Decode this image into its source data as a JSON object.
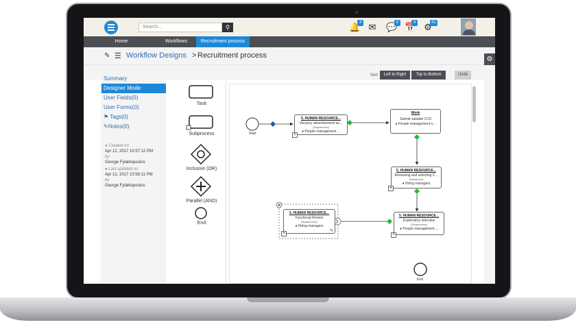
{
  "topbar": {
    "search_placeholder": "Search...",
    "badges": {
      "notifications": "4",
      "chat": "0",
      "calendar": "4",
      "settings": "41"
    }
  },
  "nav": {
    "tabs": [
      {
        "label": "Home"
      },
      {
        "label": "Workflows"
      },
      {
        "label": "Recruitment process"
      }
    ]
  },
  "breadcrumb": {
    "root": "Workflow Designs",
    "separator": ">",
    "current": "Recruitment process"
  },
  "toolbar": {
    "sort_label": "Sort",
    "left_to_right": "Left to Right",
    "top_to_bottom": "Top to Bottom",
    "undo": "Undo"
  },
  "sidebar": {
    "items": [
      {
        "label": "Summary"
      },
      {
        "label": "Designer Mode"
      },
      {
        "label": "User Fields(0)"
      },
      {
        "label": "User Forms(0)"
      },
      {
        "label": "Tags(0)"
      },
      {
        "label": "Notes(0)"
      }
    ],
    "meta": {
      "created_label": "Created on",
      "created_date": "Apr 12, 2017 10:57:12 PM",
      "by_label": "by",
      "created_by": "George Fylaktopoulos",
      "updated_label": "Last updated on",
      "updated_date": "Apr 12, 2017 10:58:11 PM",
      "updated_by": "George Fylaktopoulos"
    }
  },
  "palette": {
    "items": [
      {
        "label": "Task"
      },
      {
        "label": "Subprocess"
      },
      {
        "label": "Inclusive (OR)"
      },
      {
        "label": "Parallel (AND)"
      },
      {
        "label": "End"
      }
    ]
  },
  "diagram": {
    "start_label": "Start",
    "end_label": "End",
    "nodes": [
      {
        "title": "5. HUMAN RESOURCE...",
        "desc": "Vacancy advertisement an...",
        "sub": "(Subprocess)",
        "people": "People management ..."
      },
      {
        "title": "Work",
        "desc": "Submit suitable CVS",
        "sub": "",
        "people": "People management o..."
      },
      {
        "title": "5. HUMAN RESOURCE...",
        "desc": "Reviewing and selecting C...",
        "sub": "Subprocess",
        "people": "Hiring managers"
      },
      {
        "title": "5. HUMAN RESOURCE...",
        "desc": "Functional Review",
        "sub": "(Subprocess)",
        "people": "Hiring managers"
      },
      {
        "title": "5. HUMAN RESOURCE...",
        "desc": "Exploratory interview",
        "sub": "(Subprocess)",
        "people": "People management ..."
      }
    ]
  },
  "colors": {
    "accent": "#1e88d8",
    "nav": "#4b4e53",
    "gateway": "#22bb33",
    "start_gateway": "#2255aa"
  }
}
